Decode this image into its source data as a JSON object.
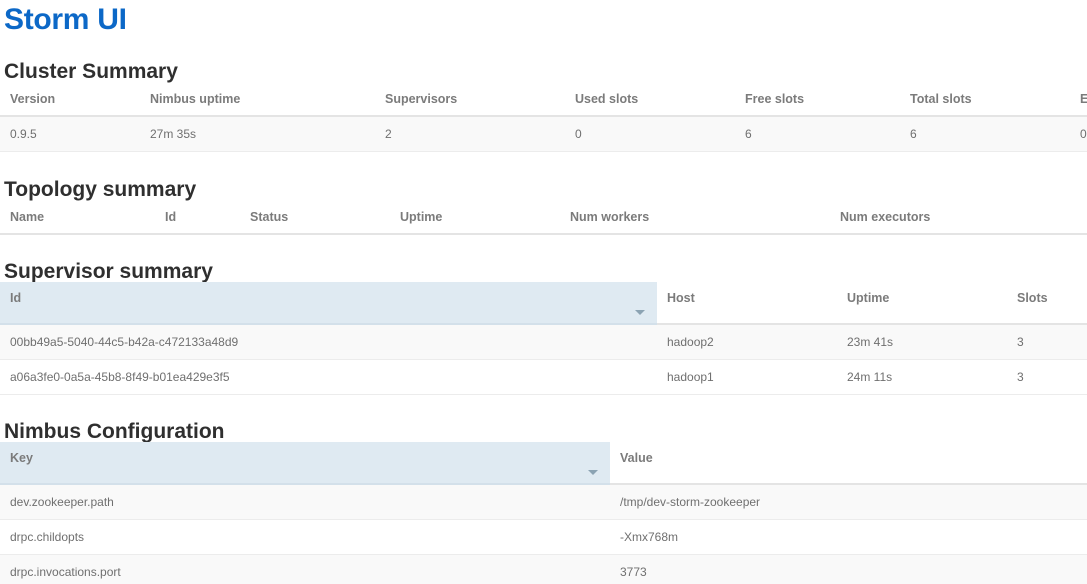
{
  "brand": {
    "title": "Storm UI"
  },
  "cluster_summary": {
    "heading": "Cluster Summary",
    "columns": [
      "Version",
      "Nimbus uptime",
      "Supervisors",
      "Used slots",
      "Free slots",
      "Total slots",
      "Ex"
    ],
    "rows": [
      {
        "version": "0.9.5",
        "nimbus_uptime": "27m 35s",
        "supervisors": "2",
        "used_slots": "0",
        "free_slots": "6",
        "total_slots": "6",
        "executors": "0"
      }
    ]
  },
  "topology_summary": {
    "heading": "Topology summary",
    "columns": [
      "Name",
      "Id",
      "Status",
      "Uptime",
      "Num workers",
      "Num executors"
    ],
    "rows": []
  },
  "supervisor_summary": {
    "heading": "Supervisor summary",
    "columns": [
      "Id",
      "Host",
      "Uptime",
      "Slots"
    ],
    "sorted_column": "Id",
    "sort_icon": "caret-down-icon",
    "rows": [
      {
        "id": "00bb49a5-5040-44c5-b42a-c472133a48d9",
        "host": "hadoop2",
        "uptime": "23m 41s",
        "slots": "3"
      },
      {
        "id": "a06a3fe0-0a5a-45b8-8f49-b01ea429e3f5",
        "host": "hadoop1",
        "uptime": "24m 11s",
        "slots": "3"
      }
    ]
  },
  "nimbus_configuration": {
    "heading": "Nimbus Configuration",
    "columns": [
      "Key",
      "Value"
    ],
    "sorted_column": "Key",
    "sort_icon": "caret-down-icon",
    "rows": [
      {
        "key": "dev.zookeeper.path",
        "value": "/tmp/dev-storm-zookeeper"
      },
      {
        "key": "drpc.childopts",
        "value": "-Xmx768m"
      },
      {
        "key": "drpc.invocations.port",
        "value": "3773"
      }
    ]
  },
  "colors": {
    "brand_blue": "#0c68c7",
    "sorted_header_bg": "#dfeaf2",
    "row_stripe": "#f9f9f9",
    "header_text": "#7b7b7b",
    "body_text": "#6f6f6f"
  }
}
